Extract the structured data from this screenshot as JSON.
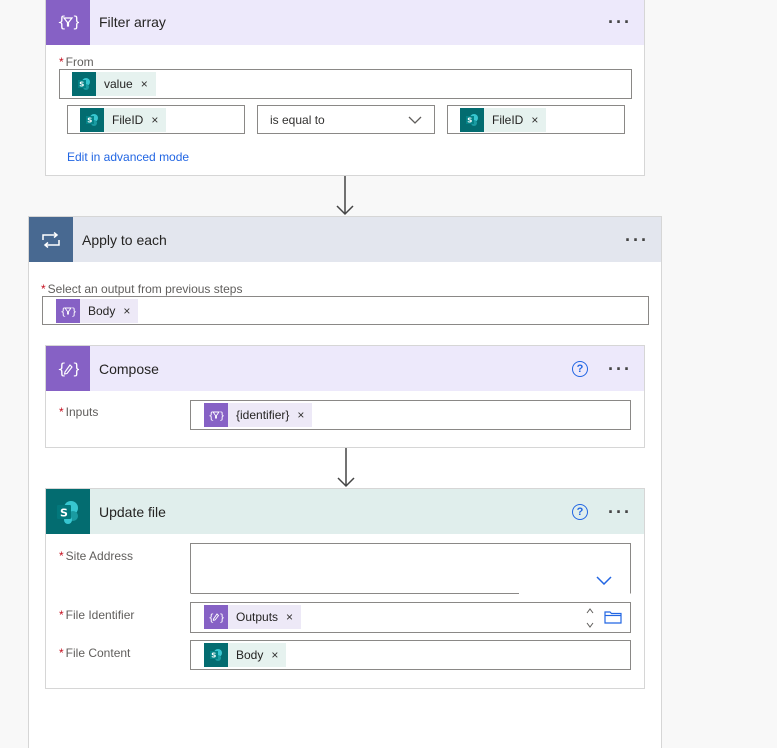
{
  "filter_array": {
    "title": "Filter array",
    "more": "···",
    "from_label": "From",
    "from_token": "value",
    "left_token": "FileID",
    "operator": "is equal to",
    "right_token": "FileID",
    "advanced_link": "Edit in advanced mode",
    "icon": "filter-curly-icon"
  },
  "apply_to_each": {
    "title": "Apply to each",
    "more": "···",
    "select_label": "Select an output from previous steps",
    "select_token": "Body",
    "icon": "loop-icon"
  },
  "compose": {
    "title": "Compose",
    "more": "···",
    "help": "?",
    "inputs_label": "Inputs",
    "inputs_token": "{identifier}",
    "icon": "compose-curly-icon"
  },
  "update_file": {
    "title": "Update file",
    "more": "···",
    "help": "?",
    "site_label": "Site Address",
    "file_id_label": "File Identifier",
    "file_id_token": "Outputs",
    "file_content_label": "File Content",
    "file_content_token": "Body",
    "icon": "sharepoint-icon"
  },
  "token_remove": "×",
  "required_mark": "*",
  "colors": {
    "filter_header": "#ede9fb",
    "filter_icon_bg": "#8661c5",
    "apply_header": "#e3e6ee",
    "apply_icon_bg": "#486991",
    "compose_header": "#ede9fb",
    "update_header": "#e0eeec",
    "update_icon_bg": "#036c70",
    "link": "#2266e3"
  }
}
